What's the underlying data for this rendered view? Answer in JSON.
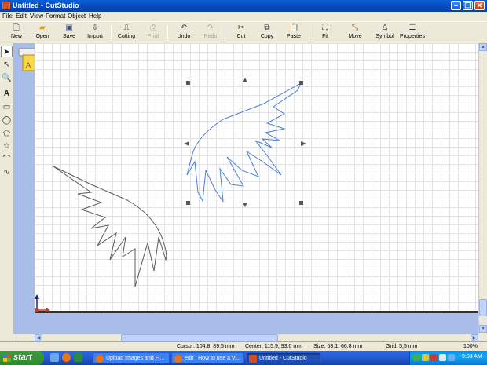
{
  "window": {
    "title": "Untitled - CutStudio"
  },
  "menu": [
    "File",
    "Edit",
    "View",
    "Format",
    "Object",
    "Help"
  ],
  "toolbar": [
    {
      "label": "New",
      "icon": "new-document-icon",
      "enabled": true
    },
    {
      "label": "Open",
      "icon": "open-folder-icon",
      "enabled": true
    },
    {
      "label": "Save",
      "icon": "save-disk-icon",
      "enabled": true
    },
    {
      "label": "Import",
      "icon": "import-icon",
      "enabled": true
    },
    {
      "label": "Cutting",
      "icon": "cutting-machine-icon",
      "enabled": true
    },
    {
      "label": "Print",
      "icon": "printer-icon",
      "enabled": false
    },
    {
      "label": "Undo",
      "icon": "undo-icon",
      "enabled": true
    },
    {
      "label": "Redo",
      "icon": "redo-icon",
      "enabled": false
    },
    {
      "label": "Cut",
      "icon": "scissors-icon",
      "enabled": true
    },
    {
      "label": "Copy",
      "icon": "copy-icon",
      "enabled": true
    },
    {
      "label": "Paste",
      "icon": "paste-icon",
      "enabled": true
    },
    {
      "label": "Fit",
      "icon": "fit-icon",
      "enabled": true
    },
    {
      "label": "Move",
      "icon": "move-icon",
      "enabled": true
    },
    {
      "label": "Symbol",
      "icon": "symbol-icon",
      "enabled": true
    },
    {
      "label": "Properties",
      "icon": "properties-icon",
      "enabled": true
    }
  ],
  "tools": [
    "select-arrow-icon",
    "node-edit-icon",
    "zoom-icon",
    "text-tool-icon",
    "rectangle-tool-icon",
    "ellipse-tool-icon",
    "polygon-tool-icon",
    "star-tool-icon",
    "polyline-tool-icon",
    "curve-tool-icon"
  ],
  "status": {
    "cursor": "Cursor: 104.8, 89.5 mm",
    "center": "Center: 115.9, 93.0 mm",
    "size": "Size: 63.1, 66.8 mm",
    "grid": "Grid: 5,5 mm",
    "zoom": "100%"
  },
  "taskbar": {
    "start_label": "start",
    "tasks": [
      {
        "label": "Upload Images and Fi...",
        "icon": "firefox-icon",
        "active": false
      },
      {
        "label": "edit : How to use a Vi...",
        "icon": "firefox-icon",
        "active": false
      },
      {
        "label": "Untitled - CutStudio",
        "icon": "cutstudio-icon",
        "active": true
      }
    ],
    "clock": "9:03 AM"
  },
  "colors": {
    "accent": "#0a5fd8",
    "wing_stroke": "#4a7fd8",
    "wing_stroke_dark": "#555555",
    "ruler": "#a8bde8"
  }
}
